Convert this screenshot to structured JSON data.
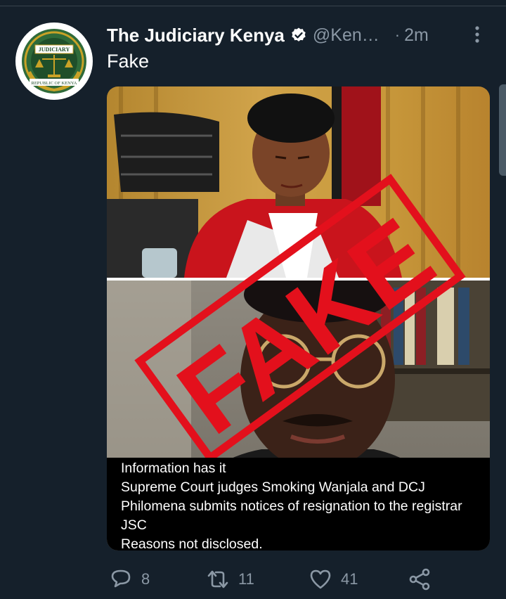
{
  "tweet": {
    "author_name": "The Judiciary Kenya",
    "handle": "@Ken…",
    "separator": "·",
    "time": "2m",
    "text": "Fake"
  },
  "avatar": {
    "seal_top": "JUDICIARY",
    "seal_bottom": "REPUBLIC OF KENYA"
  },
  "media": {
    "stamp": "FAKE",
    "caption": "Information has it\nSupreme Court judges Smoking Wanjala and DCJ Philomena submits notices of resignation to the registrar JSC\nReasons not disclosed."
  },
  "actions": {
    "replies": "8",
    "retweets": "11",
    "likes": "41"
  },
  "colors": {
    "background": "#15202b",
    "secondary_text": "#8b98a5",
    "stamp_red": "#e3101c",
    "seal_green": "#2f6b3a",
    "seal_gold": "#c9a227"
  },
  "icons": [
    "verified-badge-icon",
    "more-vertical-icon",
    "reply-icon",
    "retweet-icon",
    "like-icon",
    "share-icon"
  ]
}
